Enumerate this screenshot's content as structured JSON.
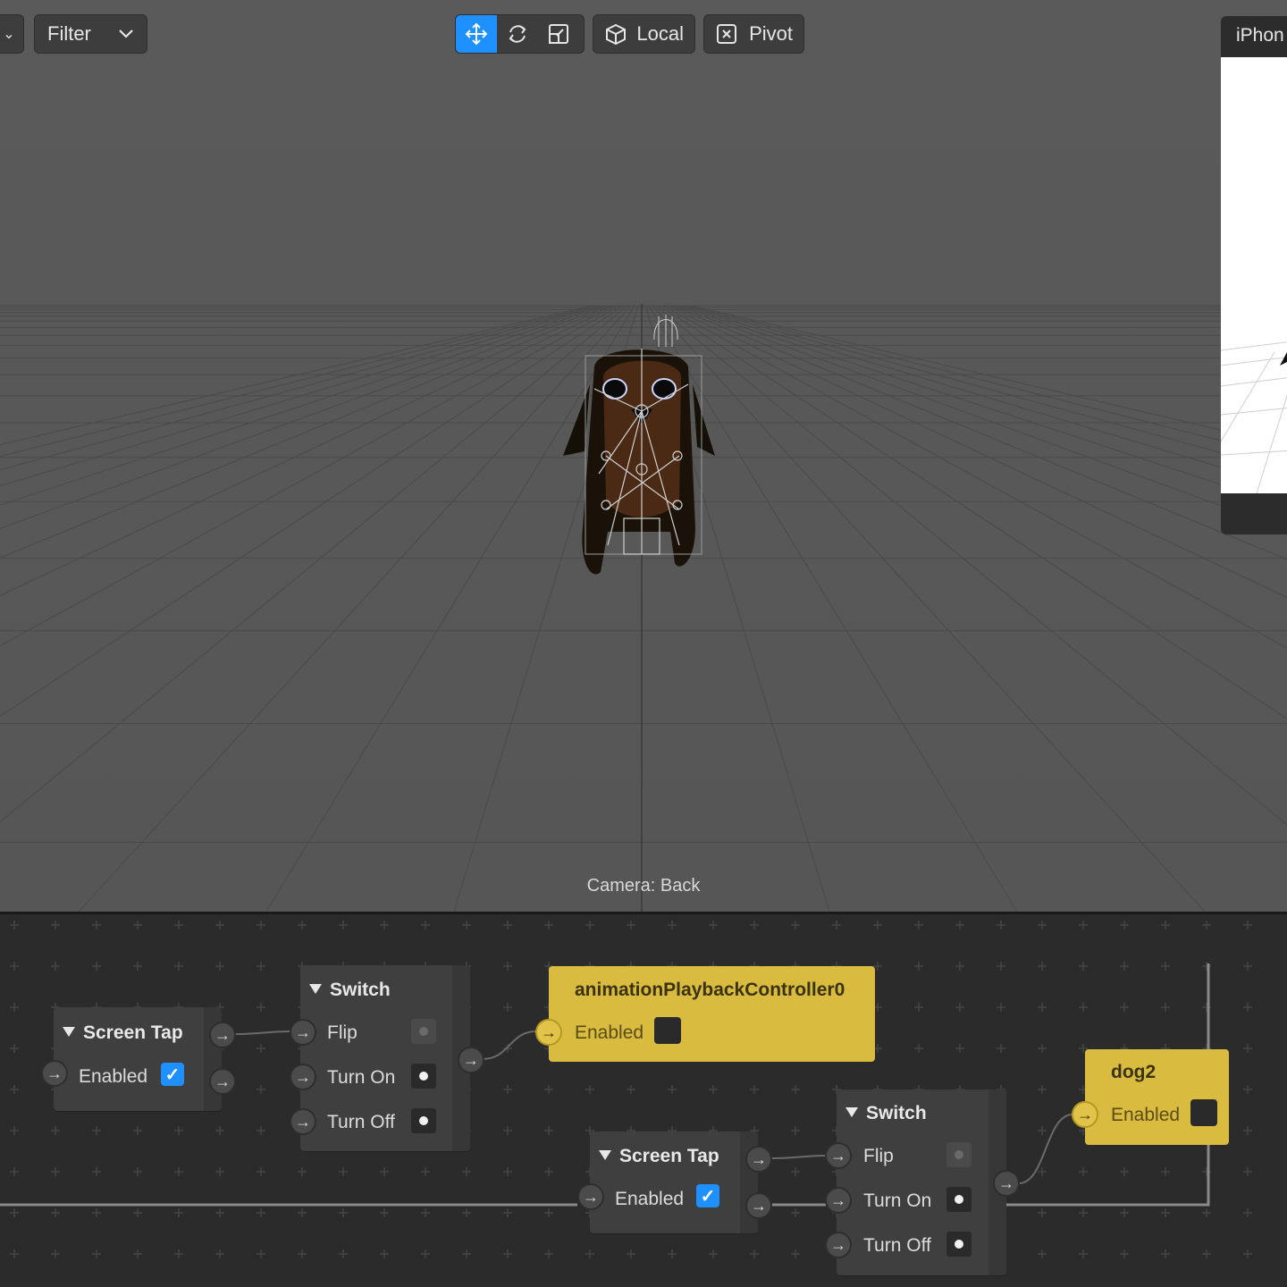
{
  "toolbar": {
    "filter_label": "Filter",
    "transform_tools": [
      "move-tool",
      "rotate-tool",
      "scale-tool"
    ],
    "space_label": "Local",
    "pivot_label": "Pivot"
  },
  "viewport": {
    "camera_label": "Camera: Back"
  },
  "preview": {
    "device_label": "iPhon"
  },
  "patch_editor": {
    "screen_tap_1": {
      "title": "Screen Tap",
      "enabled_label": "Enabled",
      "enabled": true
    },
    "switch_1": {
      "title": "Switch",
      "rows": [
        "Flip",
        "Turn On",
        "Turn Off"
      ]
    },
    "anim_controller": {
      "title": "animationPlaybackController0",
      "enabled_label": "Enabled"
    },
    "screen_tap_2": {
      "title": "Screen Tap",
      "enabled_label": "Enabled",
      "enabled": true
    },
    "switch_2": {
      "title": "Switch",
      "rows": [
        "Flip",
        "Turn On",
        "Turn Off"
      ]
    },
    "dog2": {
      "title": "dog2",
      "enabled_label": "Enabled"
    }
  },
  "colors": {
    "accent": "#1e90ff",
    "patch_yellow": "#d9bb3f",
    "viewport_bg": "#595959",
    "patch_bg": "#2b2b2b"
  }
}
